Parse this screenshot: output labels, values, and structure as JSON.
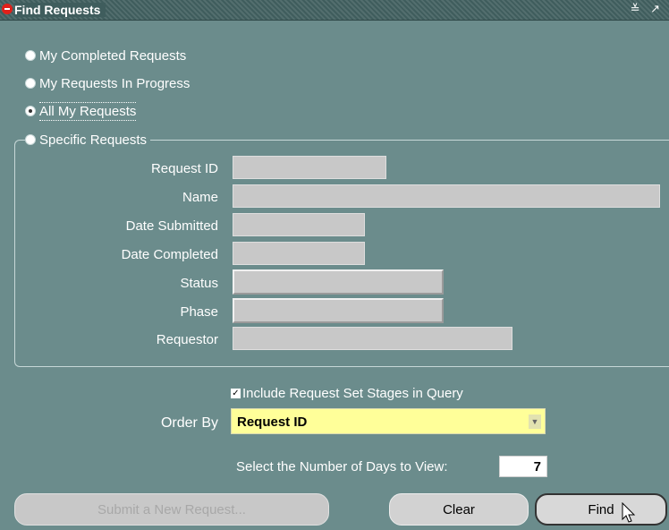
{
  "window": {
    "title": "Find Requests",
    "controls": "≚ ↗"
  },
  "request_type": {
    "options": [
      {
        "label": "My Completed Requests",
        "checked": false
      },
      {
        "label": "My Requests In Progress",
        "checked": false
      },
      {
        "label": "All My Requests",
        "checked": true
      },
      {
        "label": "Specific Requests",
        "checked": false
      }
    ]
  },
  "fields": {
    "request_id": {
      "label": "Request ID",
      "value": ""
    },
    "name": {
      "label": "Name",
      "value": ""
    },
    "date_submitted": {
      "label": "Date Submitted",
      "value": ""
    },
    "date_completed": {
      "label": "Date Completed",
      "value": ""
    },
    "status": {
      "label": "Status",
      "value": ""
    },
    "phase": {
      "label": "Phase",
      "value": ""
    },
    "requestor": {
      "label": "Requestor",
      "value": ""
    }
  },
  "include_stages": {
    "label": "Include Request Set Stages in Query",
    "checked": true,
    "mark": "✓"
  },
  "order_by": {
    "label": "Order By",
    "value": "Request ID"
  },
  "days": {
    "label": "Select the Number of Days to View:",
    "value": "7"
  },
  "buttons": {
    "submit": "Submit a New Request...",
    "clear": "Clear",
    "find": "Find"
  },
  "colors": {
    "background": "#6b8c8c",
    "select_bg": "#ffff99",
    "field_bg": "#c8c8c8"
  }
}
